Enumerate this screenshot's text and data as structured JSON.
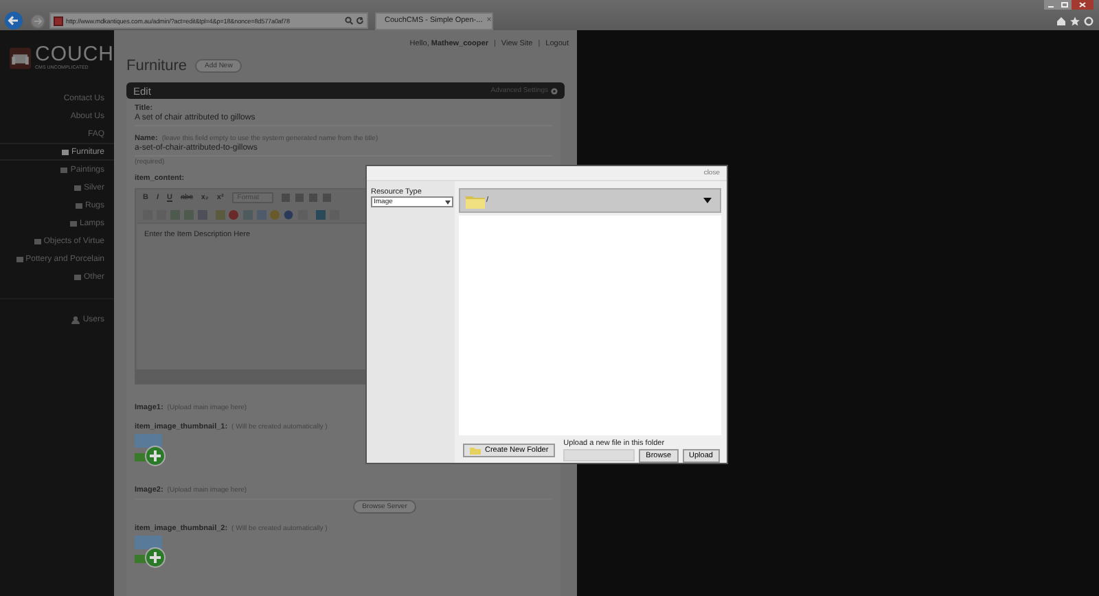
{
  "browser": {
    "address": "http://www.mdkantiques.com.au/admin/?act=edit&tpl=4&p=18&nonce=8d577a0af78",
    "tab_title": "CouchCMS - Simple Open-...",
    "tab_close": "×"
  },
  "header": {
    "logo": "COUCH",
    "tagline": "CMS UNCOMPLICATED",
    "greeting": "Hello,",
    "user": "Mathew_cooper",
    "links": [
      "View Site",
      "Logout"
    ],
    "separators": [
      "|",
      "|"
    ]
  },
  "sidebar": {
    "items": [
      {
        "label": "Contact Us",
        "kind": "page",
        "selected": false
      },
      {
        "label": "About Us",
        "kind": "page",
        "selected": false
      },
      {
        "label": "FAQ",
        "kind": "page",
        "selected": false
      },
      {
        "label": "Furniture",
        "kind": "folder",
        "selected": true
      },
      {
        "label": "Paintings",
        "kind": "folder",
        "selected": false
      },
      {
        "label": "Silver",
        "kind": "folder",
        "selected": false
      },
      {
        "label": "Rugs",
        "kind": "folder",
        "selected": false
      },
      {
        "label": "Lamps",
        "kind": "folder",
        "selected": false
      },
      {
        "label": "Objects of Virtue",
        "kind": "folder",
        "selected": false
      },
      {
        "label": "Pottery and Porcelain",
        "kind": "folder",
        "selected": false
      },
      {
        "label": "Other",
        "kind": "folder",
        "selected": false
      },
      {
        "label": "Users",
        "kind": "users",
        "selected": false
      }
    ]
  },
  "page": {
    "title": "Furniture",
    "add_button": "Add New",
    "panel_title": "Edit",
    "advanced": "Advanced Settings",
    "title_field": {
      "label": "Title:",
      "value": "A set of chair attributed to gillows"
    },
    "name_field": {
      "label": "Name:",
      "hint": "(leave this field empty to use the system generated name from the title)",
      "value": "a-set-of-chair-attributed-to-gillows",
      "note": "(required)"
    },
    "content_field": {
      "label": "item_content:",
      "toolbar": [
        "B",
        "I",
        "U",
        "abc",
        "x₂",
        "x²"
      ],
      "format": "Format",
      "text": "Enter the Item Description Here"
    },
    "fields": [
      {
        "kind": "image",
        "label": "Image1:",
        "hint": "(Upload main image here)"
      },
      {
        "kind": "thumb",
        "label": "item_image_thumbnail_1:",
        "hint": "( Will be created automatically )"
      },
      {
        "kind": "image",
        "label": "Image2:",
        "hint": "(Upload main image here)",
        "button": "Browse Server"
      },
      {
        "kind": "thumb",
        "label": "item_image_thumbnail_2:",
        "hint": "( Will be created automatically )"
      }
    ]
  },
  "dialog": {
    "close": "close",
    "resource_label": "Resource Type",
    "resource_value": "Image",
    "path": "/",
    "new_folder": "Create New Folder",
    "upload_label": "Upload a new file in this folder",
    "browse": "Browse",
    "upload": "Upload"
  }
}
